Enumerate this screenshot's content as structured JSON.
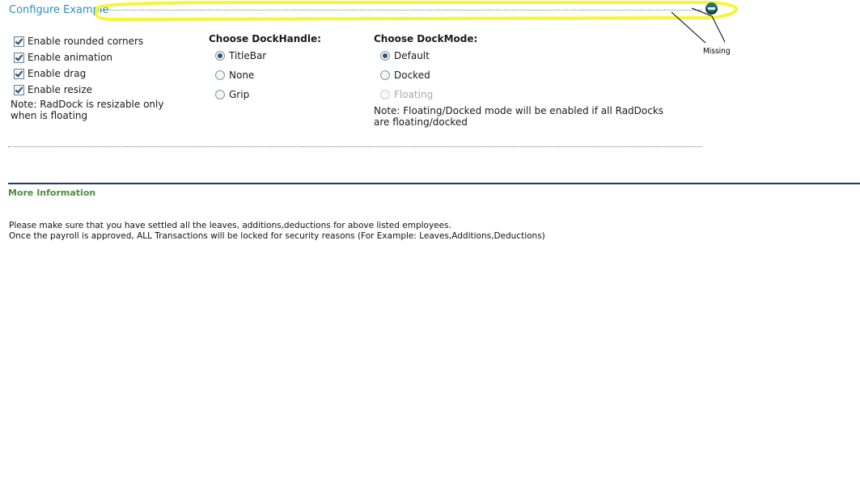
{
  "configure": {
    "title": "Configure Example",
    "annotation_label": "Missing"
  },
  "options": {
    "checkboxes": [
      {
        "label": "Enable rounded corners",
        "checked": true
      },
      {
        "label": "Enable animation",
        "checked": true
      },
      {
        "label": "Enable drag",
        "checked": true
      },
      {
        "label": "Enable resize",
        "checked": true
      }
    ],
    "resize_note": "Note: RadDock is resizable only when is floating"
  },
  "dock_handle": {
    "heading": "Choose DockHandle:",
    "options": [
      {
        "label": "TitleBar",
        "selected": true
      },
      {
        "label": "None",
        "selected": false
      },
      {
        "label": "Grip",
        "selected": false
      }
    ]
  },
  "dock_mode": {
    "heading": "Choose DockMode:",
    "options": [
      {
        "label": "Default",
        "selected": true,
        "enabled": true
      },
      {
        "label": "Docked",
        "selected": false,
        "enabled": true
      },
      {
        "label": "Floating",
        "selected": false,
        "enabled": false
      }
    ],
    "note": "Note: Floating/Docked mode will be enabled if all RadDocks are floating/docked"
  },
  "more_info": {
    "title": "More Information",
    "lines": [
      "Please make sure that you have settled all the leaves, additions,deductions for above listed employees.",
      "Once the payroll is approved, ALL Transactions will be locked for security reasons (For Example: Leaves,Additions,Deductions)"
    ]
  },
  "colors": {
    "title_blue": "#2a8fc4",
    "annotation_yellow": "#f5f53a",
    "info_green": "#4b8f3a",
    "rule_navy": "#1b3a74"
  }
}
